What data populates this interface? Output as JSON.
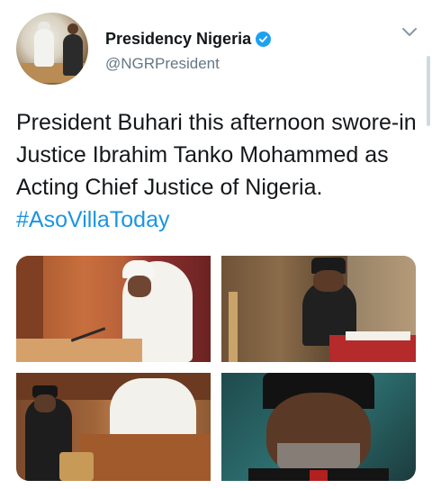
{
  "account": {
    "display_name": "Presidency Nigeria",
    "handle": "@NGRPresident",
    "verified": true
  },
  "tweet": {
    "text": "President Buhari this afternoon swore-in Justice Ibrahim Tanko Mohammed as Acting Chief Justice of Nigeria.",
    "hashtag": "#AsoVillaToday"
  },
  "media": {
    "photo_count": 4
  },
  "icons": {
    "verified": "verified-badge-icon",
    "menu": "chevron-down-icon"
  },
  "colors": {
    "link": "#1b95e0",
    "verified": "#1da1f2",
    "text": "#14171a",
    "muted": "#657786"
  }
}
